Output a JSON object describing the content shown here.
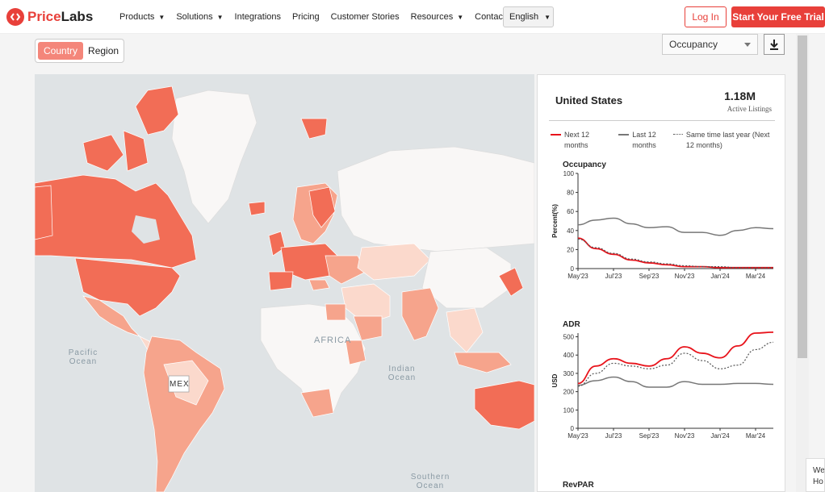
{
  "brand": {
    "name_a": "Price",
    "name_b": "Labs"
  },
  "nav": [
    {
      "label": "Products",
      "chevron": true
    },
    {
      "label": "Solutions",
      "chevron": true
    },
    {
      "label": "Integrations",
      "chevron": false
    },
    {
      "label": "Pricing",
      "chevron": false
    },
    {
      "label": "Customer Stories",
      "chevron": false
    },
    {
      "label": "Resources",
      "chevron": true
    },
    {
      "label": "Contact",
      "chevron": false
    }
  ],
  "language": "English",
  "login_label": "Log In",
  "trial_label": "Start Your Free Trial",
  "view_toggle": {
    "active": "Country",
    "inactive": "Region"
  },
  "metric_select": "Occupancy",
  "map_labels": {
    "pacific": "Pacific Ocean",
    "indian": "Indian Ocean",
    "southern": "Southern Ocean",
    "africa": "AFRICA",
    "mex": "MEX"
  },
  "panel": {
    "country": "United States",
    "listings_value": "1.18M",
    "listings_label": "Active Listings",
    "legend": [
      "Next 12 months",
      "Last 12 months",
      "Same time last year (Next 12 months)"
    ]
  },
  "colors": {
    "accent": "#e8403a",
    "next": "#e8131b",
    "last": "#777777",
    "same": "#555555",
    "heat_high": "#f26d56",
    "heat_mid": "#f6a48c",
    "heat_low": "#fbd9cc"
  },
  "chart_data": [
    {
      "type": "line",
      "title": "Occupancy",
      "ylabel": "Percent(%)",
      "ylim": [
        0,
        100
      ],
      "yticks": [
        0,
        20,
        40,
        60,
        80,
        100
      ],
      "xticks": [
        "May'23",
        "Jul'23",
        "Sep'23",
        "Nov'23",
        "Jan'24",
        "Mar'24"
      ],
      "x": [
        "May'23",
        "Jun'23",
        "Jul'23",
        "Aug'23",
        "Sep'23",
        "Oct'23",
        "Nov'23",
        "Dec'23",
        "Jan'24",
        "Feb'24",
        "Mar'24",
        "Apr'24"
      ],
      "series": [
        {
          "name": "Next 12 months",
          "values": [
            32,
            21,
            15,
            9,
            6,
            4,
            2,
            2,
            1,
            1,
            1,
            1
          ]
        },
        {
          "name": "Last 12 months",
          "values": [
            46,
            51,
            53,
            47,
            43,
            44,
            38,
            38,
            35,
            40,
            43,
            42
          ]
        },
        {
          "name": "Same time last year (Next 12 months)",
          "values": [
            31,
            22,
            16,
            10,
            7,
            5,
            3,
            2,
            2,
            1,
            1,
            1
          ]
        }
      ]
    },
    {
      "type": "line",
      "title": "ADR",
      "ylabel": "USD",
      "ylim": [
        0,
        520
      ],
      "yticks": [
        0,
        100,
        200,
        300,
        400,
        500
      ],
      "xticks": [
        "May'23",
        "Jul'23",
        "Sep'23",
        "Nov'23",
        "Jan'24",
        "Mar'24"
      ],
      "x": [
        "May'23",
        "Jun'23",
        "Jul'23",
        "Aug'23",
        "Sep'23",
        "Oct'23",
        "Nov'23",
        "Dec'23",
        "Jan'24",
        "Feb'24",
        "Mar'24",
        "Apr'24"
      ],
      "series": [
        {
          "name": "Next 12 months",
          "values": [
            245,
            340,
            380,
            355,
            340,
            380,
            445,
            410,
            385,
            450,
            520,
            525
          ]
        },
        {
          "name": "Last 12 months",
          "values": [
            235,
            260,
            280,
            255,
            225,
            225,
            255,
            240,
            240,
            245,
            245,
            240
          ]
        },
        {
          "name": "Same time last year (Next 12 months)",
          "values": [
            230,
            300,
            355,
            340,
            325,
            345,
            410,
            370,
            325,
            345,
            430,
            470
          ]
        }
      ]
    }
  ],
  "next_section": "RevPAR",
  "chat_text": [
    "We",
    "Ho"
  ]
}
